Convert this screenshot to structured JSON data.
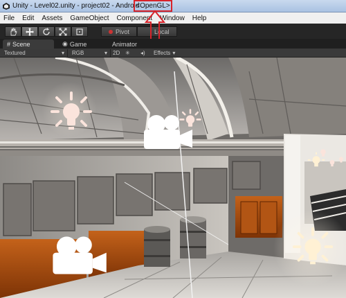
{
  "window": {
    "title": "Unity - Level02.unity - project02 - Android",
    "renderer_badge": "<OpenGL>"
  },
  "menu": [
    "File",
    "Edit",
    "Assets",
    "GameObject",
    "Component",
    "Window",
    "Help"
  ],
  "toolbar": {
    "pivot_label": "Pivot",
    "local_label": "Local"
  },
  "tabs": {
    "scene": "Scene",
    "game": "Game",
    "animator": "Animator"
  },
  "scene_bar": {
    "shading_mode": "Textured",
    "render_mode": "RGB",
    "dimension_toggle": "2D",
    "effects_label": "Effects"
  },
  "colors": {
    "highlight": "#d8232a",
    "light_icon": "#ffe9d0",
    "camera_icon": "#ffffff",
    "editor_dark": "#262626"
  },
  "icons": {
    "light_gizmo": "light-bulb-icon",
    "camera_gizmo": "camera-icon"
  }
}
